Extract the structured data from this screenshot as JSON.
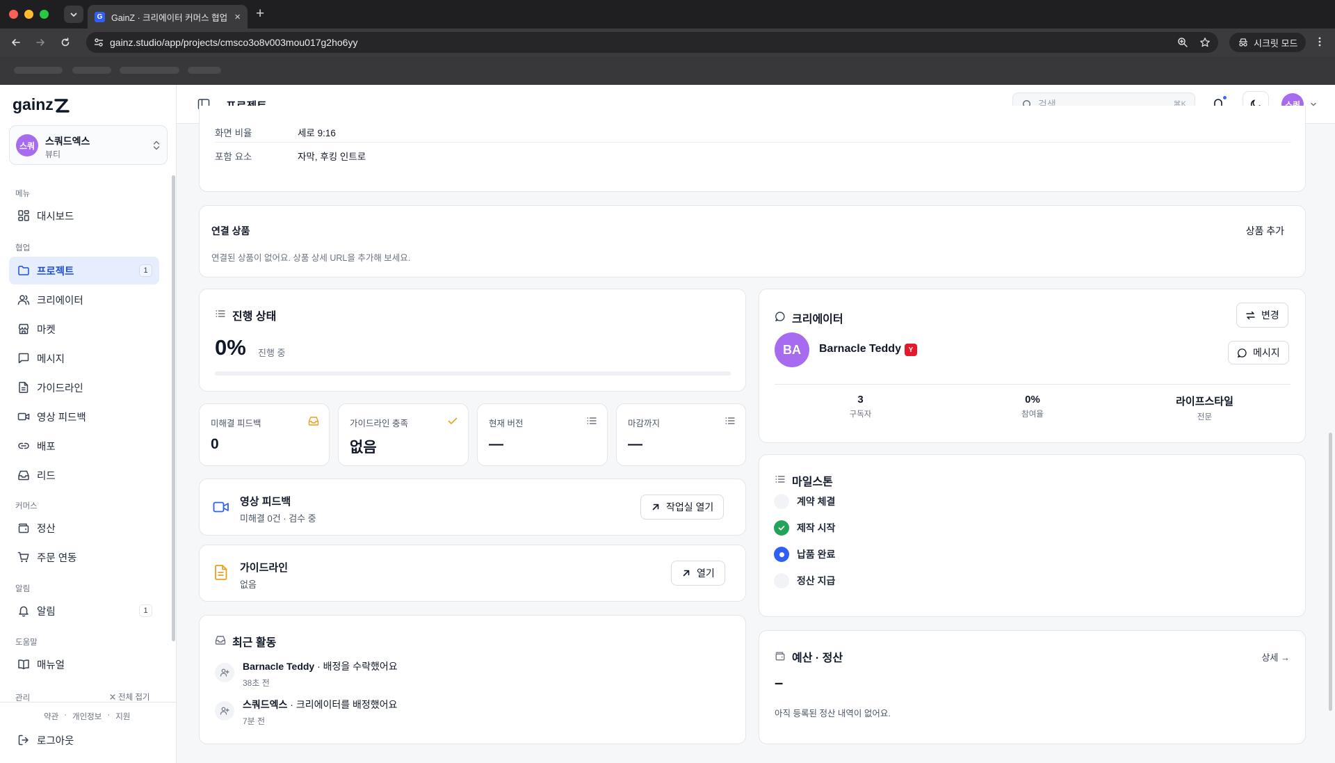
{
  "browser": {
    "tab_favicon_letter": "G",
    "tab_title": "GainZ · 크리에이터 커머스 협업 OS",
    "url": "gainz.studio/app/projects/cmsco3o8v003mou017g2ho6yy",
    "incognito_label": "시크릿 모드"
  },
  "sidebar": {
    "logo_text": "gainz",
    "workspace": {
      "avatar": "스쿼",
      "name": "스쿼드엑스",
      "category": "뷰티"
    },
    "groups": {
      "menu": "메뉴",
      "collab": "협업",
      "commerce": "커머스",
      "alerts": "알림",
      "help": "도움말",
      "admin": "관리"
    },
    "items": {
      "dashboard": "대시보드",
      "projects": "프로젝트",
      "projects_badge": "1",
      "creators": "크리에이터",
      "market": "마켓",
      "messages": "메시지",
      "guidelines": "가이드라인",
      "video_feedback": "영상 피드백",
      "deploy": "배포",
      "leads": "리드",
      "settlement": "정산",
      "order_sync": "주문 연동",
      "notifications": "알림",
      "notifications_badge": "1",
      "manual": "매뉴얼"
    },
    "collapse_all": "전체 접기",
    "footer": {
      "terms": "약관",
      "privacy": "개인정보",
      "support": "지원"
    },
    "logout": "로그아웃"
  },
  "header": {
    "title": "프로젝트",
    "search_placeholder": "검색",
    "search_shortcut": "⌘K",
    "user_avatar": "스쿼"
  },
  "brief": {
    "rows": [
      {
        "label": "화면 비율",
        "value": "세로 9:16"
      },
      {
        "label": "포함 요소",
        "value": "자막, 후킹 인트로"
      }
    ]
  },
  "products": {
    "title": "연결 상품",
    "add_label": "상품 추가",
    "empty_text": "연결된 상품이 없어요. 상품 상세 URL을 추가해 보세요."
  },
  "progress": {
    "title": "진행 상태",
    "percent_text": "0%",
    "percent_value": 0,
    "status": "진행 중"
  },
  "stats": [
    {
      "label": "미해결 피드백",
      "value": "0",
      "icon": "inbox-icon"
    },
    {
      "label": "가이드라인 충족",
      "value": "없음",
      "icon": "check-icon"
    },
    {
      "label": "현재 버전",
      "value": "—",
      "icon": "list-icon"
    },
    {
      "label": "마감까지",
      "value": "—",
      "icon": "list-icon"
    }
  ],
  "video_feedback": {
    "title": "영상 피드백",
    "sub": "미해결 0건 · 검수 중",
    "button": "작업실 열기"
  },
  "guideline": {
    "title": "가이드라인",
    "sub": "없음",
    "button": "열기"
  },
  "activity": {
    "title": "최근 활동",
    "items": [
      {
        "actor": "Barnacle Teddy",
        "action": " · 배정을 수락했어요",
        "time": "38초 전"
      },
      {
        "actor": "스쿼드엑스",
        "action": " · 크리에이터를 배정했어요",
        "time": "7분 전"
      }
    ]
  },
  "creator": {
    "title": "크리에이터",
    "change_button": "변경",
    "avatar": "BA",
    "name": "Barnacle Teddy",
    "platform_badge": "Y",
    "message_button": "메시지",
    "stats": [
      {
        "value": "3",
        "label": "구독자"
      },
      {
        "value": "0%",
        "label": "참여율"
      },
      {
        "value": "라이프스타일",
        "label": "전문"
      }
    ]
  },
  "milestones": {
    "title": "마일스톤",
    "items": [
      {
        "label": "계약 체결",
        "state": "pending"
      },
      {
        "label": "제작 시작",
        "state": "done"
      },
      {
        "label": "납품 완료",
        "state": "current"
      },
      {
        "label": "정산 지급",
        "state": "pending"
      }
    ]
  },
  "budget": {
    "title": "예산 · 정산",
    "detail_link": "상세 →",
    "amount": "–",
    "empty_text": "아직 등록된 정산 내역이 없어요."
  },
  "colors": {
    "accent": "#2f5ff5",
    "avatar_purple": "#a76bf0",
    "success": "#22a35a",
    "warning": "#e8a020",
    "youtube": "#e5192e"
  }
}
